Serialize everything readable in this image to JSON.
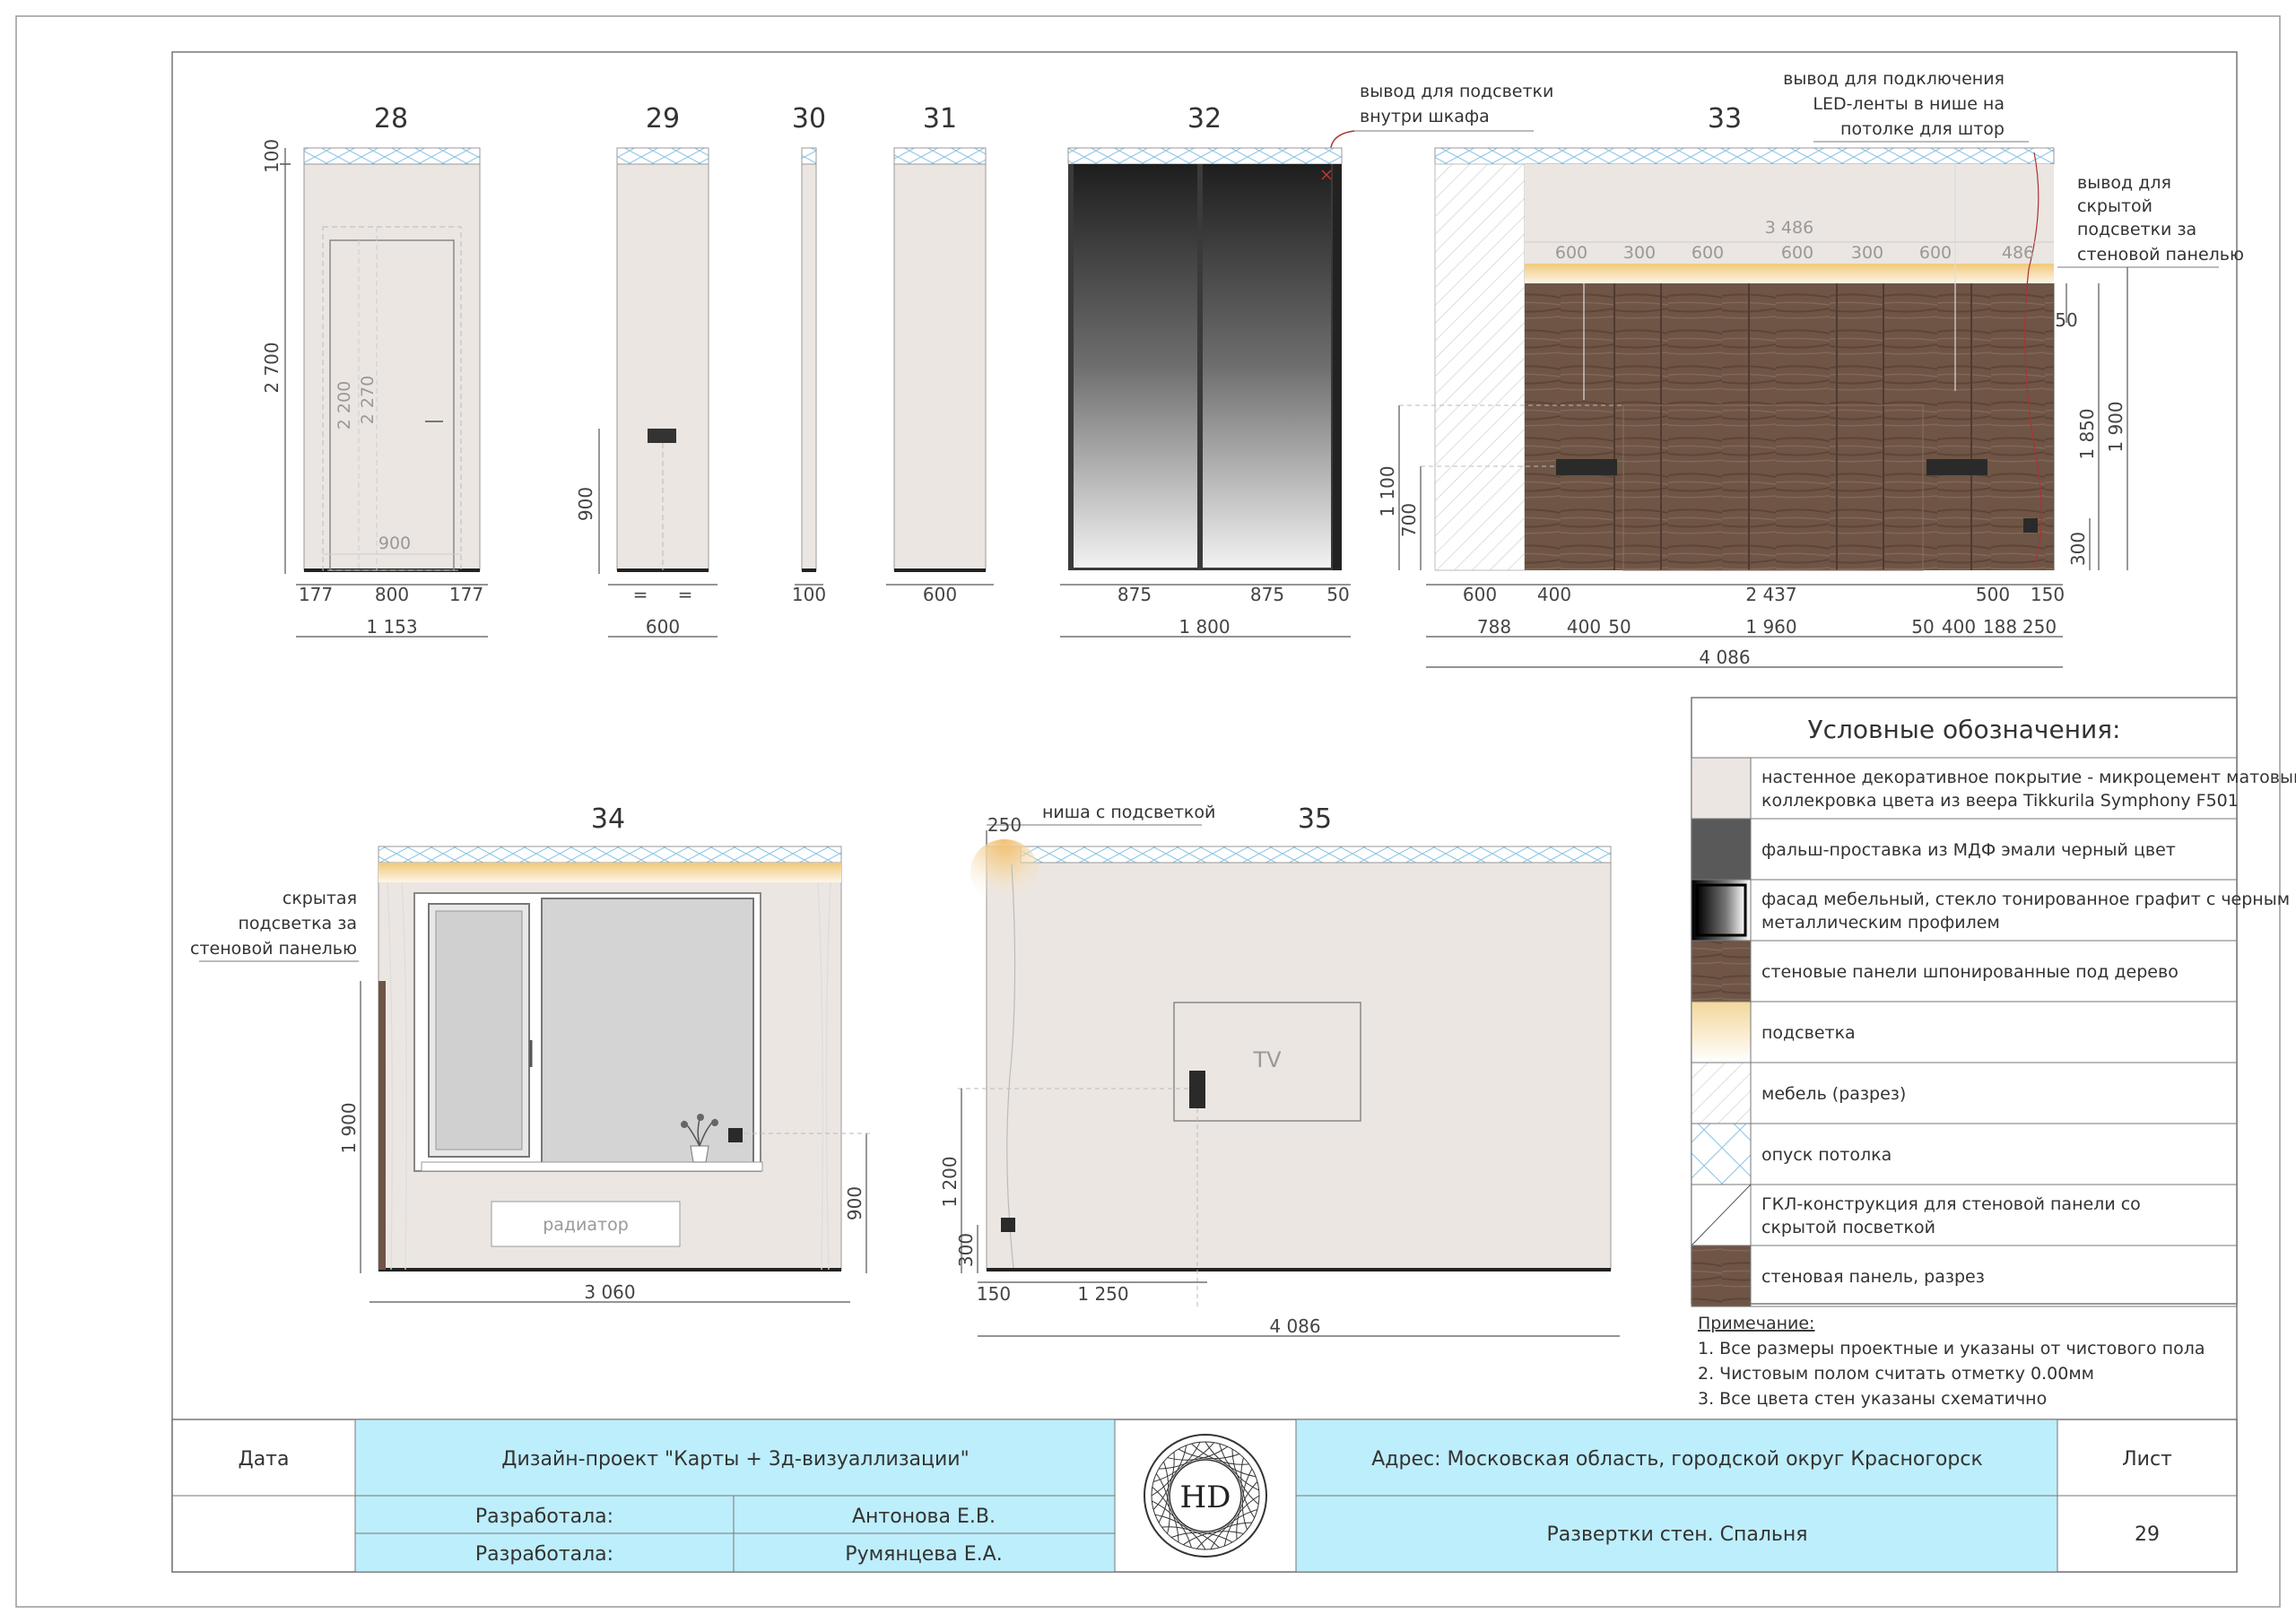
{
  "elevations": {
    "e28": {
      "number": "28",
      "dim_top": "100",
      "dim_height": "2 700",
      "dim_door_h1": "2 200",
      "dim_door_h2": "2 270",
      "dim_door_w": "900",
      "dim_l": "177",
      "dim_mid": "800",
      "dim_r": "177",
      "dim_total": "1 153"
    },
    "e29": {
      "number": "29",
      "dim_socket": "900",
      "eq1": "=",
      "eq2": "=",
      "dim_total": "600"
    },
    "e30": {
      "number": "30",
      "dim_total": "100"
    },
    "e31": {
      "number": "31",
      "dim_total": "600"
    },
    "e32": {
      "number": "32",
      "note": [
        "вывод для подсветки",
        "внутри шкафа"
      ],
      "dim_a": "875",
      "dim_b": "875",
      "dim_c": "50",
      "dim_total": "1 800"
    },
    "e33": {
      "number": "33",
      "note_led": [
        "вывод для подключения",
        "LED-ленты в нише на",
        "потолке для штор"
      ],
      "note_hidden": [
        "вывод для",
        "скрытой",
        "подсветки за",
        "стеновой панелью"
      ],
      "dim_ceiling": "3 486",
      "ceiling_dims": [
        "600",
        "300",
        "600",
        "600",
        "300",
        "600",
        "486"
      ],
      "dim_50": "50",
      "dim_1850": "1 850",
      "dim_1900": "1 900",
      "dim_300": "300",
      "dim_1100": "1 100",
      "dim_700": "700",
      "row1": [
        "600",
        "400",
        "2 437",
        "500",
        "150"
      ],
      "row2": [
        "788",
        "400",
        "50",
        "1 960",
        "50",
        "400",
        "188",
        "250"
      ],
      "dim_total": "4 086"
    },
    "e34": {
      "number": "34",
      "note": [
        "скрытая",
        "подсветка за",
        "стеновой панелью"
      ],
      "radiator": "радиатор",
      "dim_1900": "1 900",
      "dim_900": "900",
      "dim_total": "3 060"
    },
    "e35": {
      "number": "35",
      "niche": "ниша с подсветкой",
      "dim_250": "250",
      "tv": "TV",
      "dim_1200": "1 200",
      "dim_300": "300",
      "dim_150": "150",
      "dim_1250": "1 250",
      "dim_total": "4 086"
    }
  },
  "legend": {
    "title": "Условные обозначения:",
    "items": [
      {
        "swatch": "microcement",
        "lines": [
          "настенное декоративное покрытие - микроцемент матовый,",
          "коллекровка цвета из веера Tikkurila Symphony F501"
        ]
      },
      {
        "swatch": "mdf",
        "lines": [
          "фальш-проставка из МДФ эмали черный цвет"
        ]
      },
      {
        "swatch": "glass",
        "lines": [
          "фасад мебельный, стекло тонированное графит с черным",
          "металлическим профилем"
        ]
      },
      {
        "swatch": "wood",
        "lines": [
          "стеновые панели шпонированные под дерево"
        ]
      },
      {
        "swatch": "light",
        "lines": [
          "подсветка"
        ]
      },
      {
        "swatch": "hatch",
        "lines": [
          "мебель (разрез)"
        ]
      },
      {
        "swatch": "ceiling",
        "lines": [
          "опуск потолка"
        ]
      },
      {
        "swatch": "gkl",
        "lines": [
          "ГКЛ-конструкция для стеновой панели со",
          "скрытой посветкой"
        ]
      },
      {
        "swatch": "wood",
        "lines": [
          "стеновая панель, разрез"
        ]
      }
    ],
    "notes_title": "Примечание:",
    "notes": [
      "1. Все размеры проектные и указаны от чистового пола",
      "2. Чистовым полом считать отметку 0.00мм",
      "3. Все цвета стен указаны схематично"
    ]
  },
  "stamp": {
    "date_label": "Дата",
    "project": "Дизайн-проект \"Карты + 3д-визуаллизации\"",
    "developed_label_1": "Разработала:",
    "developer_1": "Антонова Е.В.",
    "developed_label_2": "Разработала:",
    "developer_2": "Румянцева Е.А.",
    "logo": "HD",
    "address": "Адрес: Московская область, городской округ Красногорск",
    "sheet_title": "Развертки стен. Спальня",
    "sheet_label": "Лист",
    "sheet_number": "29"
  },
  "colors": {
    "wall": "#ebe6e2",
    "wood": "#6e5546",
    "stamp_fill": "#bdeefb",
    "light": "#f6deae",
    "ceiling_x": "#8cc4e4"
  }
}
